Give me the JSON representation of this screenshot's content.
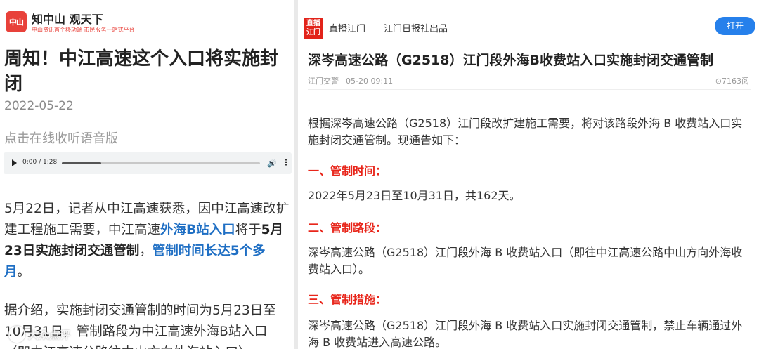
{
  "left": {
    "logo_text": "中山",
    "brand_name": "知中山 观天下",
    "brand_slogan": "中山资讯首个移动端  市民服务一站式平台",
    "title": "周知！中江高速这个入口将实施封闭",
    "date": "2022-05-22",
    "listen_label": "点击在线收听语音版",
    "player": {
      "time": "0:00 / 1:28",
      "progress": 0
    },
    "para1": {
      "t1": "5月22日，记者从中江高速获悉，因中江高速改扩建工程施工需要，中江高速",
      "t2": "外海B站入口",
      "t3": "将于",
      "t4": "5月23日实施封闭交通管制",
      "t5": "，",
      "t6": "管制时间长达5个多月",
      "t7": "。"
    },
    "para2": "据介绍，实施封闭交通管制的时间为5月23日至10月31日，管制路段为中江高速外海B站入口（即中江高速公路往中山方向外海站入口）。",
    "watermark": "大众点评"
  },
  "right": {
    "logo_text_1": "直播",
    "logo_text_2": "江门",
    "source": "直播江门——江门日报社出品",
    "open_button": "打开",
    "title": "深岑高速公路（G2518）江门段外海B收费站入口实施封闭交通管制",
    "author": "江门交警",
    "time": "05-20 09:11",
    "views": "⊙7163阅",
    "intro": "根据深岑高速公路（G2518）江门段改扩建施工需要，将对该路段外海 B 收费站入口实施封闭交通管制。现通告如下：",
    "h1": "一、管制时间：",
    "p1": "2022年5月23日至10月31日，共162天。",
    "h2": "二、管制路段：",
    "p2": "深岑高速公路（G2518）江门段外海 B 收费站入口（即往中江高速公路中山方向外海收费站入口）。",
    "h3": "三、管制措施：",
    "p3": "深岑高速公路（G2518）江门段外海 B 收费站入口实施封闭交通管制，禁止车辆通过外海 B 收费站进入高速公路。"
  },
  "colors": {
    "accent_red": "#e8261b",
    "link_blue": "#1f6fc4",
    "button_blue": "#2680eb"
  }
}
